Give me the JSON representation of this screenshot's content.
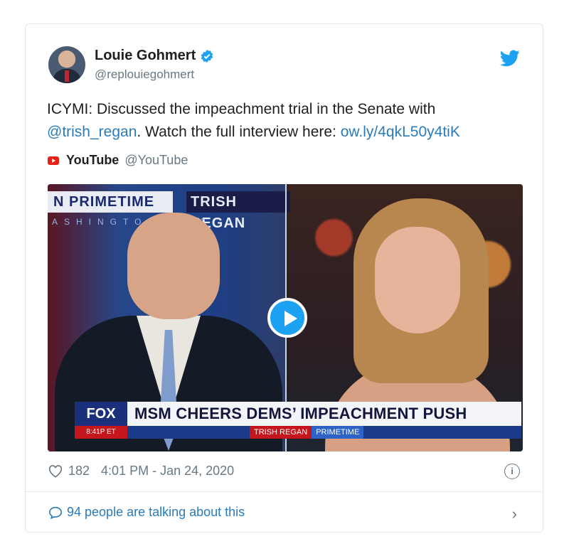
{
  "author": {
    "name": "Louie Gohmert",
    "handle": "@replouiegohmert",
    "verified": true
  },
  "tweet": {
    "text_prefix": "ICYMI: Discussed the impeachment trial in the Senate with",
    "mention": "@trish_regan",
    "text_middle": ". Watch the full interview here: ",
    "link": "ow.ly/4qkL50y4tiK"
  },
  "source": {
    "name": "YouTube",
    "handle": "@YouTube"
  },
  "video": {
    "banner_left": "N PRIMETIME",
    "banner_right": "TRISH REGAN",
    "city": "ASHINGTON, D.C.",
    "network_logo": "FOX",
    "headline": "MSM CHEERS DEMS’ IMPEACHMENT PUSH",
    "strip_time": "8:41P ET",
    "strip_show_a": "TRISH REGAN",
    "strip_show_b": "PRIMETIME"
  },
  "meta": {
    "likes": "182",
    "timestamp": "4:01 PM - Jan 24, 2020",
    "info_icon": "i"
  },
  "footer": {
    "talking": "94 people are talking about this",
    "chevron": "›"
  },
  "colors": {
    "link": "#2b7bb9",
    "verified": "#1da1f2",
    "youtube": "#e62117",
    "muted": "#697882"
  }
}
